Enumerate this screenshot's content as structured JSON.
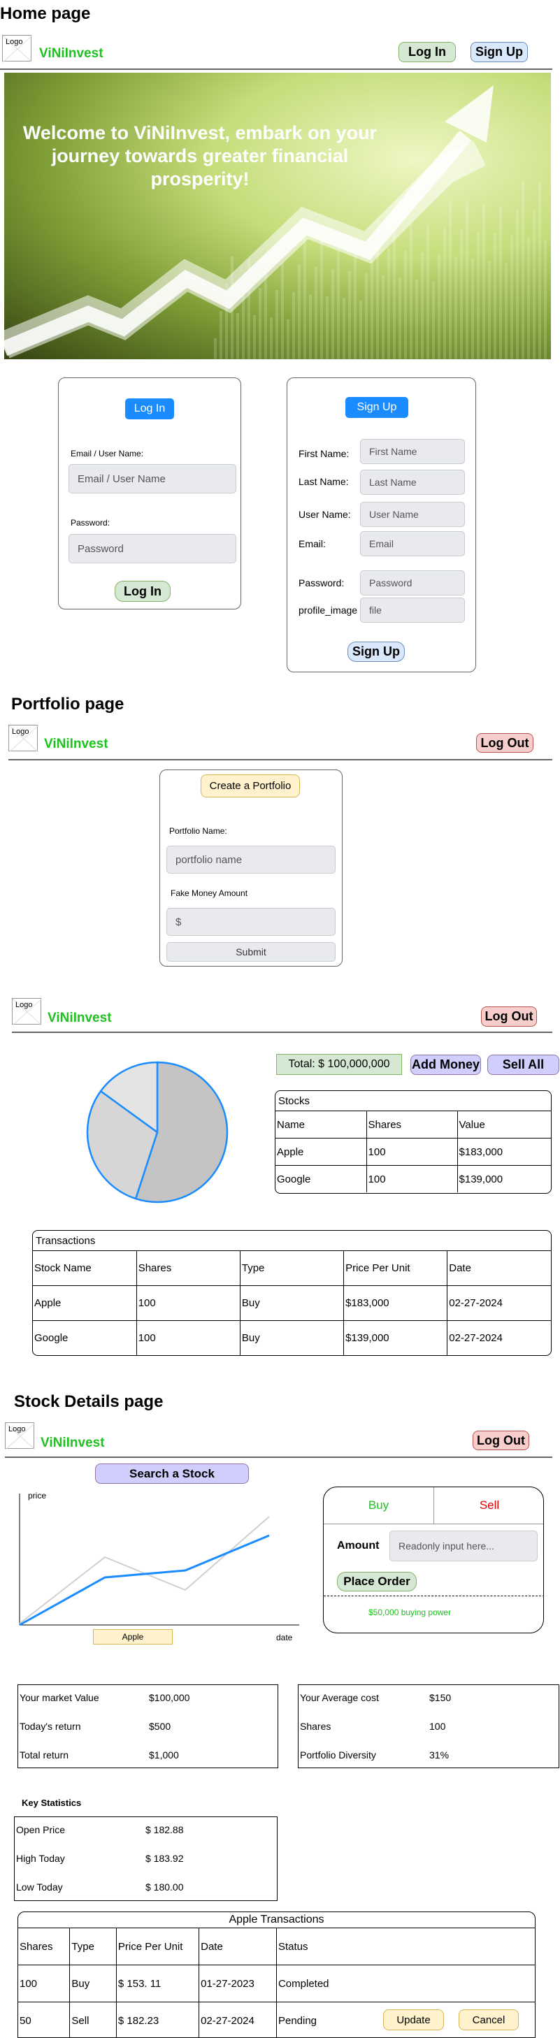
{
  "home": {
    "section_title": "Home page",
    "logo": "Logo",
    "brand": "ViNiInvest",
    "login_btn": "Log In",
    "signup_btn": "Sign Up",
    "hero_text": "Welcome to ViNiInvest, embark on your journey towards greater financial prosperity!",
    "login_card": {
      "title": "Log In",
      "email_label": "Email / User Name:",
      "email_placeholder": "Email / User Name",
      "password_label": "Password:",
      "password_placeholder": "Password",
      "submit": "Log In"
    },
    "signup_card": {
      "title": "Sign Up",
      "fields": [
        {
          "label": "First Name:",
          "placeholder": "First Name"
        },
        {
          "label": "Last Name:",
          "placeholder": "Last Name"
        },
        {
          "label": "User Name:",
          "placeholder": "User Name"
        },
        {
          "label": "Email:",
          "placeholder": "Email"
        },
        {
          "label": "Password:",
          "placeholder": "Password"
        },
        {
          "label": "profile_image",
          "placeholder": "file"
        }
      ],
      "submit": "Sign Up"
    }
  },
  "portfolio": {
    "section_title": "Portfolio page",
    "logo": "Logo",
    "brand": "ViNiInvest",
    "logout_btn": "Log Out",
    "create_btn": "Create a Portfolio",
    "name_label": "Portfolio Name:",
    "name_placeholder": "portfolio name",
    "money_label": "Fake Money Amount",
    "money_placeholder": "$",
    "submit": "Submit"
  },
  "dashboard": {
    "logo": "Logo",
    "brand": "ViNiInvest",
    "logout_btn": "Log Out",
    "total": "Total: $ 100,000,000",
    "add_money": "Add Money",
    "sell_all": "Sell All",
    "pie": {
      "slices": [
        55,
        30,
        15
      ],
      "colors": [
        "#c4c4c4",
        "#d6d6d6",
        "#e4e4e4"
      ],
      "stroke": "#1a8cff"
    },
    "stocks": {
      "caption": "Stocks",
      "headers": [
        "Name",
        "Shares",
        "Value"
      ],
      "rows": [
        [
          "Apple",
          "100",
          "$183,000"
        ],
        [
          "Google",
          "100",
          "$139,000"
        ]
      ]
    },
    "transactions": {
      "caption": "Transactions",
      "headers": [
        "Stock Name",
        "Shares",
        "Type",
        "Price Per Unit",
        "Date"
      ],
      "rows": [
        [
          "Apple",
          "100",
          "Buy",
          "$183,000",
          "02-27-2024"
        ],
        [
          "Google",
          "100",
          "Buy",
          "$139,000",
          "02-27-2024"
        ]
      ]
    }
  },
  "stock": {
    "section_title": "Stock Details page",
    "logo": "Logo",
    "brand": "ViNiInvest",
    "logout_btn": "Log Out",
    "search_btn": "Search a Stock",
    "chart": {
      "ylabel": "price",
      "xlabel": "date",
      "ticker": "Apple"
    },
    "trade": {
      "buy_tab": "Buy",
      "sell_tab": "Sell",
      "amount_label": "Amount",
      "amount_placeholder": "Readonly input here...",
      "place_order": "Place Order",
      "buying_power": "$50,000 buying power"
    },
    "market": [
      {
        "label": "Your market Value",
        "value": "$100,000"
      },
      {
        "label": "Today's return",
        "value": "$500"
      },
      {
        "label": "Total return",
        "value": "$1,000"
      }
    ],
    "position": [
      {
        "label": "Your Average cost",
        "value": "$150"
      },
      {
        "label": "Shares",
        "value": "100"
      },
      {
        "label": "Portfolio Diversity",
        "value": "31%"
      }
    ],
    "key_stats_title": "Key Statistics",
    "key_stats": [
      {
        "label": "Open Price",
        "value": "$ 182.88"
      },
      {
        "label": "High Today",
        "value": "$ 183.92"
      },
      {
        "label": "Low Today",
        "value": "$ 180.00"
      }
    ],
    "transactions": {
      "caption": "Apple Transactions",
      "headers": [
        "Shares",
        "Type",
        "Price Per Unit",
        "Date",
        "Status"
      ],
      "rows": [
        [
          "100",
          "Buy",
          "$ 153. 11",
          "01-27-2023",
          "Completed"
        ],
        [
          "50",
          "Sell",
          "$ 182.23",
          "02-27-2024",
          "Pending"
        ]
      ],
      "update_btn": "Update",
      "cancel_btn": "Cancel"
    }
  }
}
